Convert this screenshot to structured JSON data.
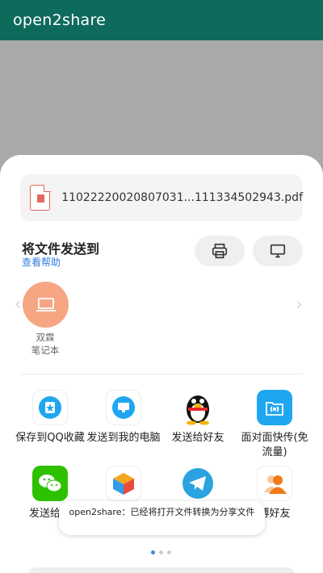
{
  "app": {
    "title": "open2share"
  },
  "file": {
    "name": "11022220020807031...111334502943.pdf"
  },
  "send": {
    "title": "将文件发送到",
    "help": "查看帮助"
  },
  "device": {
    "name": "双霖\n笔记本"
  },
  "apps": [
    {
      "label": "保存到QQ收藏",
      "icon": "qq-favorites-icon"
    },
    {
      "label": "发送到我的电脑",
      "icon": "my-computer-icon"
    },
    {
      "label": "发送给好友",
      "icon": "qq-penguin-icon"
    },
    {
      "label": "面对面快传(免流量)",
      "icon": "face-to-face-transfer-icon"
    },
    {
      "label": "发送给朋",
      "icon": "wechat-icon"
    },
    {
      "label": "",
      "icon": "colorful-cube-icon"
    },
    {
      "label": "",
      "icon": "telegram-icon"
    },
    {
      "label": "博好友",
      "icon": "weibo-contacts-icon"
    }
  ],
  "toast": {
    "text": "open2share：已经将打开文件转换为分享文件"
  },
  "colors": {
    "appbar": "#0e6b5c",
    "link": "#2f7de1",
    "device": "#f6a683",
    "wechat": "#2dc100",
    "telegram": "#2aa3e0"
  }
}
